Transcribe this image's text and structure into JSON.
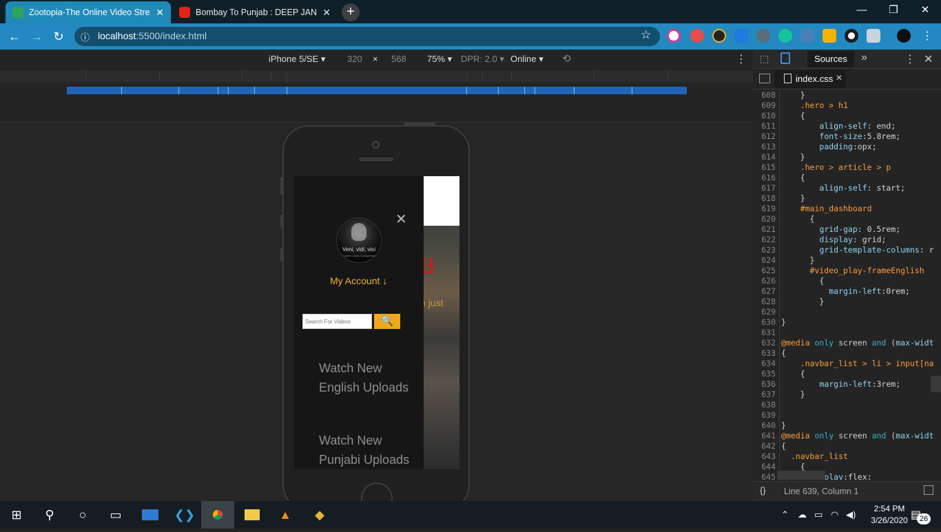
{
  "browser": {
    "tabs": [
      {
        "title": "Zootopia-The Online Video Strea",
        "active": true
      },
      {
        "title": "Bombay To Punjab : DEEP JANDU",
        "active": false
      }
    ],
    "url_host": "localhost",
    "url_path": ":5500/index.html"
  },
  "device_toolbar": {
    "device": "iPhone 5/SE",
    "width": "320",
    "times": "×",
    "height": "568",
    "zoom": "75%",
    "dpr": "DPR: 2.0",
    "network": "Online"
  },
  "site": {
    "hero_title_fragment": "ia",
    "hero_sub_fragment": "ch just",
    "avatar_text": "Veni, vidi, vici",
    "avatar_small": "I came, I saw, I conquered",
    "my_account": "My Account ↓",
    "search_placeholder": "Search For Videos",
    "menu": [
      "Watch New",
      "English Uploads",
      "Watch New",
      "Punjabi Uploads"
    ]
  },
  "devtools": {
    "panel_tab": "Sources",
    "file_tab": "index.css",
    "status": "Line 639, Column 1",
    "lines": [
      {
        "n": "608",
        "t": "    }"
      },
      {
        "n": "609",
        "t": "    .hero > h1"
      },
      {
        "n": "610",
        "t": "    {"
      },
      {
        "n": "611",
        "t": "        align-self: end;"
      },
      {
        "n": "612",
        "t": "        font-size:5.8rem;"
      },
      {
        "n": "613",
        "t": "        padding:opx;"
      },
      {
        "n": "614",
        "t": "    }"
      },
      {
        "n": "615",
        "t": "    .hero > article > p"
      },
      {
        "n": "616",
        "t": "    {"
      },
      {
        "n": "617",
        "t": "        align-self: start;"
      },
      {
        "n": "618",
        "t": "    }"
      },
      {
        "n": "619",
        "t": "    #main_dashboard"
      },
      {
        "n": "620",
        "t": "      {"
      },
      {
        "n": "621",
        "t": "        grid-gap: 0.5rem;"
      },
      {
        "n": "622",
        "t": "        display: grid;"
      },
      {
        "n": "623",
        "t": "        grid-template-columns: r"
      },
      {
        "n": "624",
        "t": "      }"
      },
      {
        "n": "625",
        "t": "      #video_play-frameEnglish"
      },
      {
        "n": "626",
        "t": "        {"
      },
      {
        "n": "627",
        "t": "          margin-left:0rem;"
      },
      {
        "n": "628",
        "t": "        }"
      },
      {
        "n": "629",
        "t": ""
      },
      {
        "n": "630",
        "t": "}"
      },
      {
        "n": "631",
        "t": ""
      },
      {
        "n": "632",
        "t": "@media only screen and (max-widt"
      },
      {
        "n": "633",
        "t": "{"
      },
      {
        "n": "634",
        "t": "    .navbar_list > li > input[na"
      },
      {
        "n": "635",
        "t": "    {"
      },
      {
        "n": "636",
        "t": "        margin-left:3rem;"
      },
      {
        "n": "637",
        "t": "    }"
      },
      {
        "n": "638",
        "t": ""
      },
      {
        "n": "639",
        "t": ""
      },
      {
        "n": "640",
        "t": "}"
      },
      {
        "n": "641",
        "t": "@media only screen and (max-widt"
      },
      {
        "n": "642",
        "t": "{"
      },
      {
        "n": "643",
        "t": "  .navbar_list"
      },
      {
        "n": "644",
        "t": "    {"
      },
      {
        "n": "645",
        "t": "       isplay:flex;"
      }
    ]
  },
  "taskbar": {
    "time": "2:54 PM",
    "date": "3/26/2020",
    "notifications": "26"
  }
}
